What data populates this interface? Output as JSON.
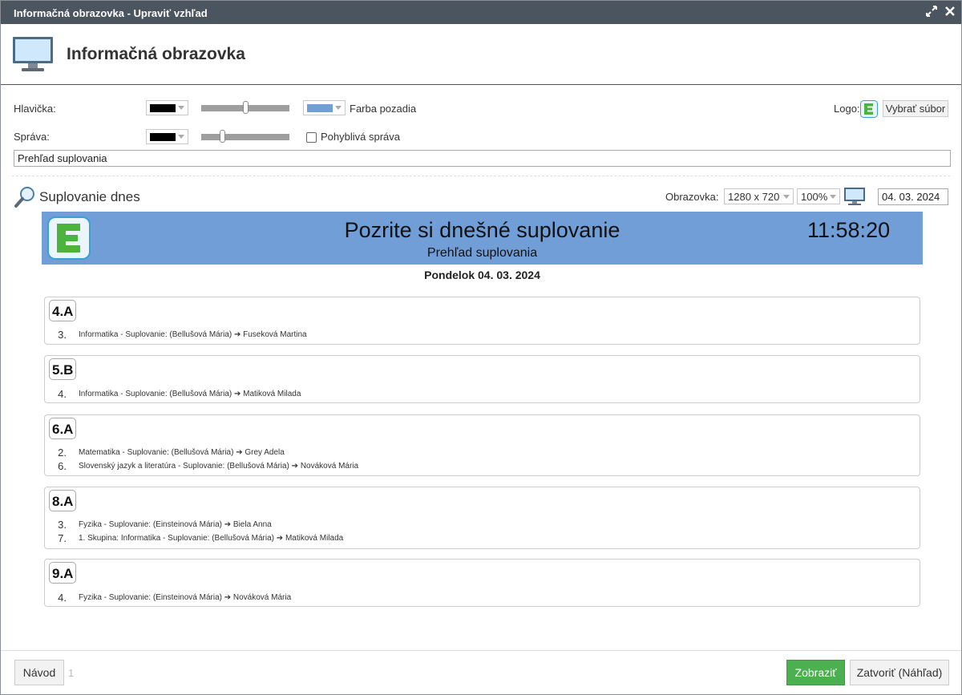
{
  "window": {
    "title": "Informačná obrazovka - Upraviť vzhľad",
    "maximize_icon": "expand-icon",
    "close_icon": "close-icon"
  },
  "header": {
    "title": "Informačná obrazovka",
    "icon": "monitor-icon"
  },
  "settings": {
    "header_label": "Hlavička:",
    "header_color": "#000000",
    "header_slider_value": 0.5,
    "bg_color": "#729ed8",
    "bg_label": "Farba pozadia",
    "message_label": "Správa:",
    "message_color": "#000000",
    "message_slider_value": 0.22,
    "moving_label": "Pohyblivá správa",
    "moving_checked": false,
    "logo_label": "Logo:",
    "choose_file_label": "Vybrať súbor",
    "message_text": "Prehľad suplovania"
  },
  "section": {
    "title": "Suplovanie dnes",
    "icon": "magnifier-icon",
    "screen_label": "Obrazovka:",
    "resolution": "1280 x 720",
    "zoom": "100%",
    "date_value": "04. 03. 2024"
  },
  "preview": {
    "heading": "Pozrite si dnešné suplovanie",
    "subheading": "Prehľad suplovania",
    "clock": "11:58:20",
    "date": "Pondelok 04. 03. 2024",
    "header_bg": "#729ed8",
    "classes": [
      {
        "name": "4.A",
        "rows": [
          {
            "lesson": "3.",
            "text": "Informatika - Suplovanie: (Bellušová Mária) ➔ Fuseková Martina"
          }
        ]
      },
      {
        "name": "5.B",
        "rows": [
          {
            "lesson": "4.",
            "text": "Informatika - Suplovanie: (Bellušová Mária) ➔ Matiková Milada"
          }
        ]
      },
      {
        "name": "6.A",
        "rows": [
          {
            "lesson": "2.",
            "text": "Matematika - Suplovanie: (Bellušová Mária) ➔ Grey Adela"
          },
          {
            "lesson": "6.",
            "text": "Slovenský jazyk a literatúra - Suplovanie: (Bellušová Mária) ➔ Nováková Mária"
          }
        ]
      },
      {
        "name": "8.A",
        "rows": [
          {
            "lesson": "3.",
            "text": "Fyzika - Suplovanie: (Einsteinová Mária) ➔ Biela Anna"
          },
          {
            "lesson": "7.",
            "text": "1. Skupina: Informatika - Suplovanie: (Bellušová Mária) ➔ Matiková Milada"
          }
        ]
      },
      {
        "name": "9.A",
        "rows": [
          {
            "lesson": "4.",
            "text": "Fyzika - Suplovanie: (Einsteinová Mária) ➔ Nováková Mária"
          }
        ]
      }
    ]
  },
  "footer": {
    "help_label": "Návod",
    "help_count": "1",
    "show_label": "Zobraziť",
    "close_label": "Zatvoriť (Náhľad)",
    "show_color": "#4caf50"
  }
}
